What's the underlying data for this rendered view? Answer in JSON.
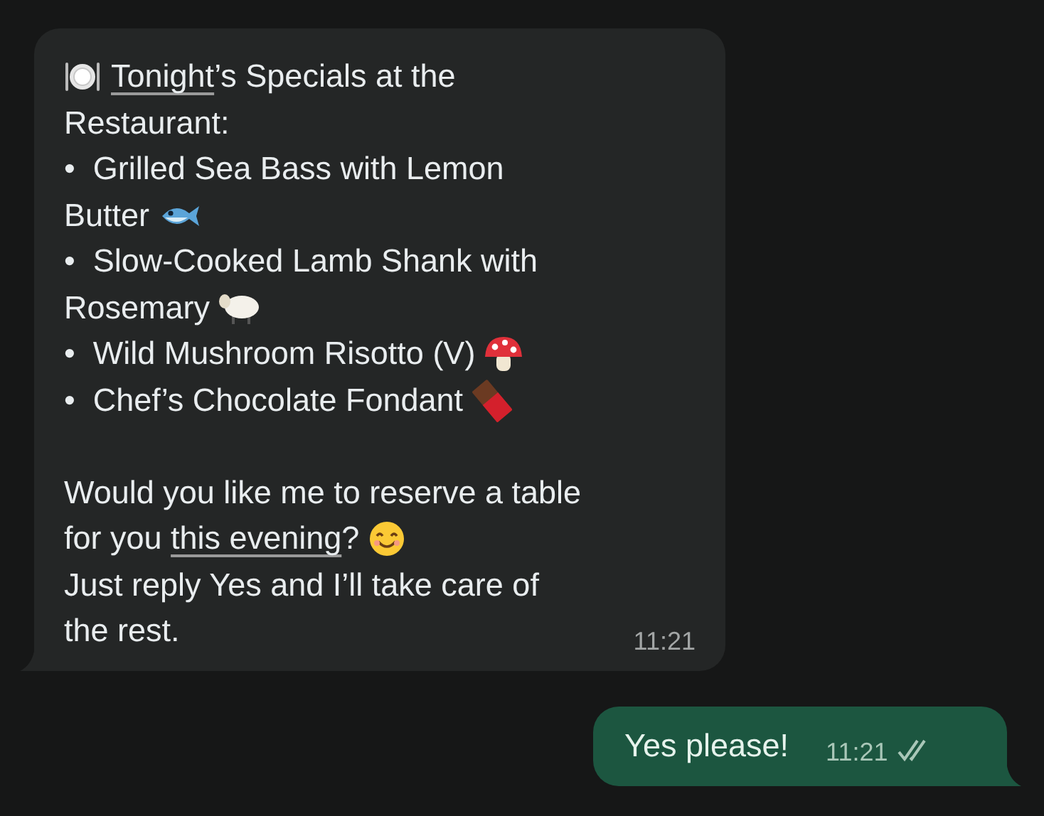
{
  "incoming": {
    "paragraphs": [
      [
        [
          {
            "kind": "icon"
          },
          {
            "kind": "link",
            "text": "Tonight"
          },
          {
            "kind": "text",
            "text": "’s Specials at the"
          }
        ],
        [
          {
            "kind": "text",
            "text": "Restaurant:"
          }
        ],
        [
          {
            "kind": "text",
            "text": "•  Grilled Sea Bass with Lemon"
          }
        ],
        [
          {
            "kind": "text",
            "text": "Butter "
          },
          {
            "kind": "icon"
          }
        ],
        [
          {
            "kind": "text",
            "text": "•  Slow-Cooked Lamb Shank with"
          }
        ],
        [
          {
            "kind": "text",
            "text": "Rosemary "
          },
          {
            "kind": "icon"
          }
        ],
        [
          {
            "kind": "text",
            "text": "•  Wild Mushroom Risotto (V) "
          },
          {
            "kind": "icon"
          }
        ],
        [
          {
            "kind": "text",
            "text": "•  Chef’s Chocolate Fondant "
          },
          {
            "kind": "icon"
          }
        ]
      ],
      [
        [
          {
            "kind": "text",
            "text": "Would you like me to reserve a table"
          }
        ],
        [
          {
            "kind": "text",
            "text": "for you "
          },
          {
            "kind": "link",
            "text": "this evening"
          },
          {
            "kind": "text",
            "text": "? "
          },
          {
            "kind": "icon"
          }
        ],
        [
          {
            "kind": "text",
            "text": "Just reply Yes and I’ll take care of"
          }
        ],
        [
          {
            "kind": "text",
            "text": "the rest."
          }
        ]
      ]
    ],
    "time": "11:21"
  },
  "outgoing": {
    "text": "Yes please!",
    "time": "11:21",
    "read": false
  }
}
